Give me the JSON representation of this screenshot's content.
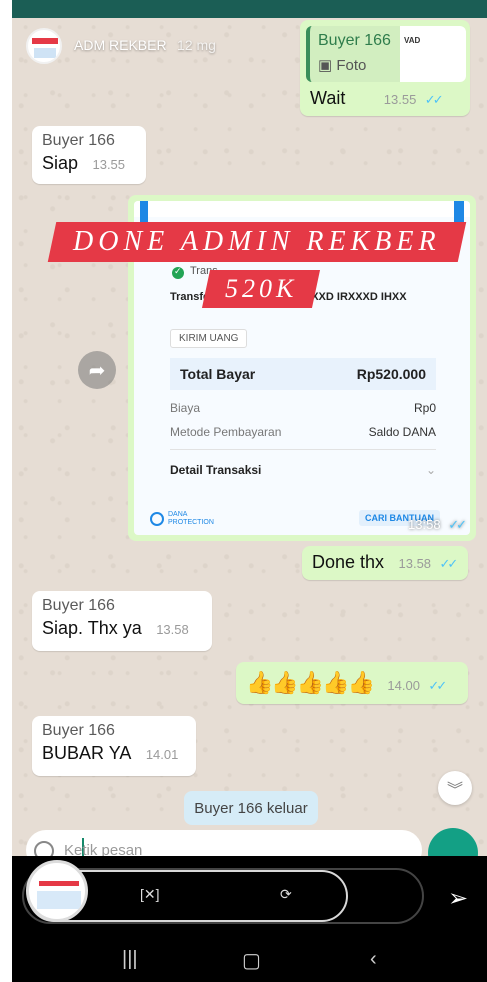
{
  "story": {
    "user": "ADM REKBER",
    "time_ago": "12 mg"
  },
  "messages": {
    "reply_quote": {
      "name": "Buyer 166",
      "type": "Foto",
      "thumb_label": "VAD"
    },
    "wait": {
      "text": "Wait",
      "time": "13.55"
    },
    "siap": {
      "sender": "Buyer 166",
      "text": "Siap",
      "time": "13.55"
    },
    "image": {
      "time": "13:58"
    },
    "done": {
      "text": "Done thx",
      "time": "13.58"
    },
    "siap_thx": {
      "sender": "Buyer 166",
      "text": "Siap. Thx ya",
      "time": "13.58"
    },
    "thumbs": {
      "text": "👍👍👍👍👍",
      "time": "14.00"
    },
    "bubar": {
      "sender": "Buyer 166",
      "text": "BUBAR YA",
      "time": "14.01"
    },
    "system": "Buyer 166 keluar"
  },
  "overlay": {
    "banner": "DONE ADMIN REKBER",
    "amount": "520K"
  },
  "receipt": {
    "status": "Trans",
    "transfer_desc": "Transfer 9 a/n OVO MUXXXXXD IRXXXD IHXX",
    "badge": "KIRIM UANG",
    "total_label": "Total Bayar",
    "total_value": "Rp520.000",
    "fee_label": "Biaya",
    "fee_value": "Rp0",
    "method_label": "Metode Pembayaran",
    "method_value": "Saldo DANA",
    "detail_label": "Detail Transaksi",
    "dana_protection": "DANA PROTECTION",
    "cari_bantuan": "CARI BANTUAN"
  },
  "composer": {
    "placeholder": "Ketik pesan"
  },
  "colors": {
    "outgoing": "#dcf8c6",
    "incoming": "#ffffff",
    "banner": "#e53946",
    "accent": "#13a085",
    "ticks": "#4fc3f7"
  },
  "icons": [
    "forward-icon",
    "scroll-down-icon",
    "send-icon",
    "emoji-icon",
    "mic-icon",
    "nav-recents-icon",
    "nav-home-icon",
    "nav-back-icon"
  ]
}
